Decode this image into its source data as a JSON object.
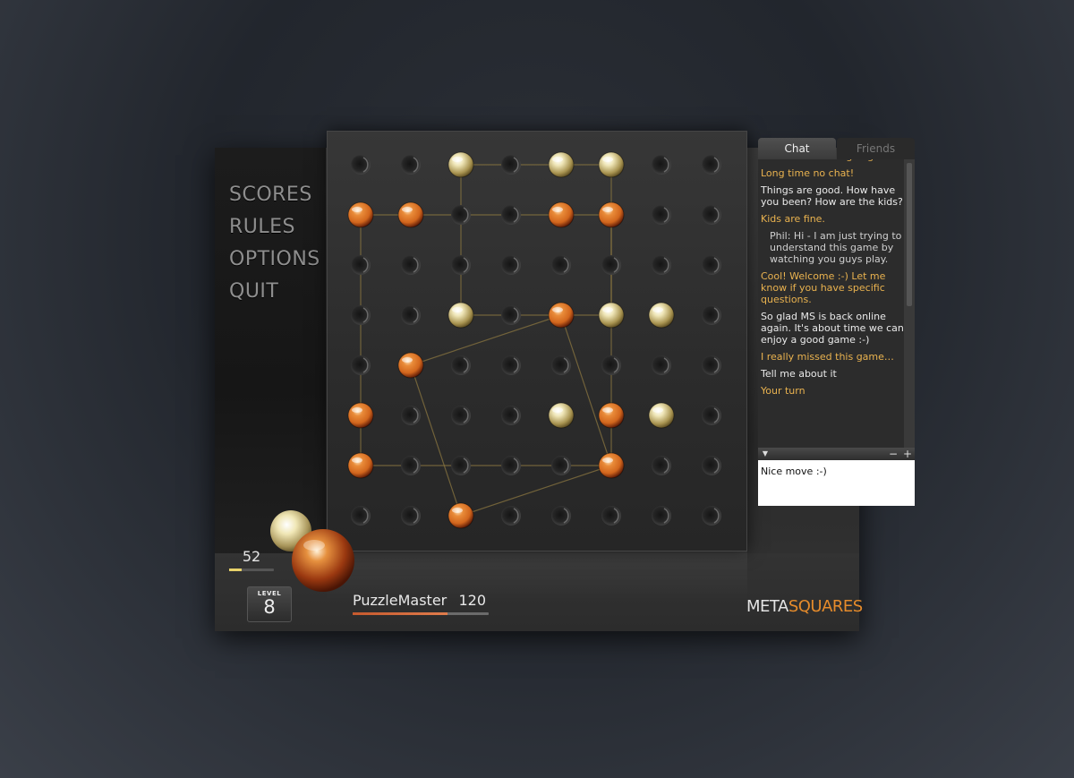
{
  "app": {
    "logo_part1": "META",
    "logo_part2": "SQUARES"
  },
  "menu": {
    "items": [
      "SCORES",
      "RULES",
      "OPTIONS",
      "QUIT"
    ]
  },
  "scores": {
    "opponent_score": "52",
    "opponent_bar_level": 0.28,
    "level_label": "LEVEL",
    "level_value": "8",
    "player_name": "PuzzleMaster",
    "player_score": "120",
    "player_bar_level": 0.7
  },
  "board": {
    "size": 8,
    "white_pieces": [
      [
        2,
        0
      ],
      [
        4,
        0
      ],
      [
        5,
        0
      ],
      [
        2,
        3
      ],
      [
        5,
        3
      ],
      [
        6,
        3
      ],
      [
        4,
        5
      ],
      [
        6,
        5
      ]
    ],
    "orange_pieces": [
      [
        0,
        1
      ],
      [
        1,
        1
      ],
      [
        4,
        1
      ],
      [
        5,
        1
      ],
      [
        4,
        3
      ],
      [
        1,
        4
      ],
      [
        0,
        5
      ],
      [
        5,
        5
      ],
      [
        0,
        6
      ],
      [
        5,
        6
      ],
      [
        2,
        7
      ]
    ],
    "squares": [
      [
        [
          2,
          0
        ],
        [
          5,
          0
        ],
        [
          5,
          3
        ],
        [
          2,
          3
        ]
      ],
      [
        [
          0,
          1
        ],
        [
          5,
          1
        ],
        [
          5,
          6
        ],
        [
          0,
          6
        ]
      ],
      [
        [
          4,
          3
        ],
        [
          5,
          6
        ],
        [
          2,
          7
        ],
        [
          1,
          4
        ]
      ]
    ],
    "colors": {
      "white": "#efe6b8",
      "orange": "#d2661d"
    }
  },
  "chat": {
    "tabs": [
      "Chat",
      "Friends"
    ],
    "active_tab": "Chat",
    "messages": [
      {
        "style": "y",
        "text": "Hi dude how is it going."
      },
      {
        "style": "y",
        "text": "Long time no chat!"
      },
      {
        "style": "w",
        "text": "Things are good. How have you been? How are the kids?"
      },
      {
        "style": "y",
        "text": "Kids are fine."
      },
      {
        "style": "g",
        "text": "Phil:  Hi - I am just trying to understand this game by watching you guys play."
      },
      {
        "style": "y",
        "text": "Cool! Welcome :-) Let me know if you have specific questions."
      },
      {
        "style": "w",
        "text": "So glad MS is back online again. It's about time we can enjoy a good game :-)"
      },
      {
        "style": "y",
        "text": "I really missed this game…"
      },
      {
        "style": "w",
        "text": "Tell me about it"
      },
      {
        "style": "y",
        "text": "Your turn"
      }
    ],
    "input_value": "Nice move :-)",
    "collapse_glyph": "▼",
    "minus_glyph": "−",
    "plus_glyph": "+"
  }
}
